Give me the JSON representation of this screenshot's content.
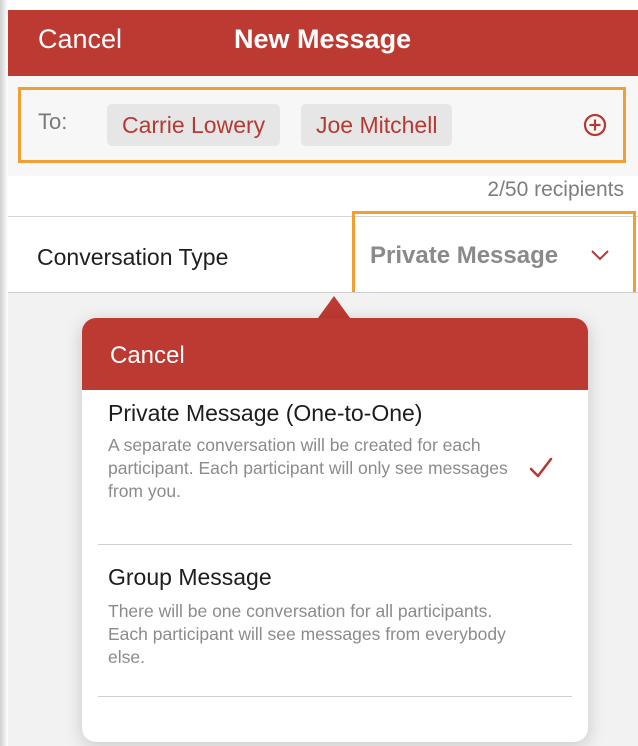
{
  "nav": {
    "cancel_label": "Cancel",
    "title": "New Message"
  },
  "to": {
    "label": "To:",
    "recipients": [
      "Carrie Lowery",
      "Joe Mitchell"
    ],
    "add_icon": "plus-circle-icon"
  },
  "recipient_count": "2/50 recipients",
  "conversation": {
    "label": "Conversation Type",
    "value": "Private Message",
    "chevron_icon": "chevron-down-icon"
  },
  "popover": {
    "cancel_label": "Cancel",
    "options": [
      {
        "title": "Private Message (One-to-One)",
        "description": "A separate conversation will be created for each participant. Each participant will only see messages from you.",
        "selected": true
      },
      {
        "title": "Group Message",
        "description": "There will be one conversation for all participants. Each participant will see messages from everybody else.",
        "selected": false
      }
    ],
    "check_icon": "checkmark-icon"
  },
  "colors": {
    "brand_red": "#bd3a32",
    "highlight_orange": "#f0a032",
    "chip_text": "#b63a34"
  }
}
